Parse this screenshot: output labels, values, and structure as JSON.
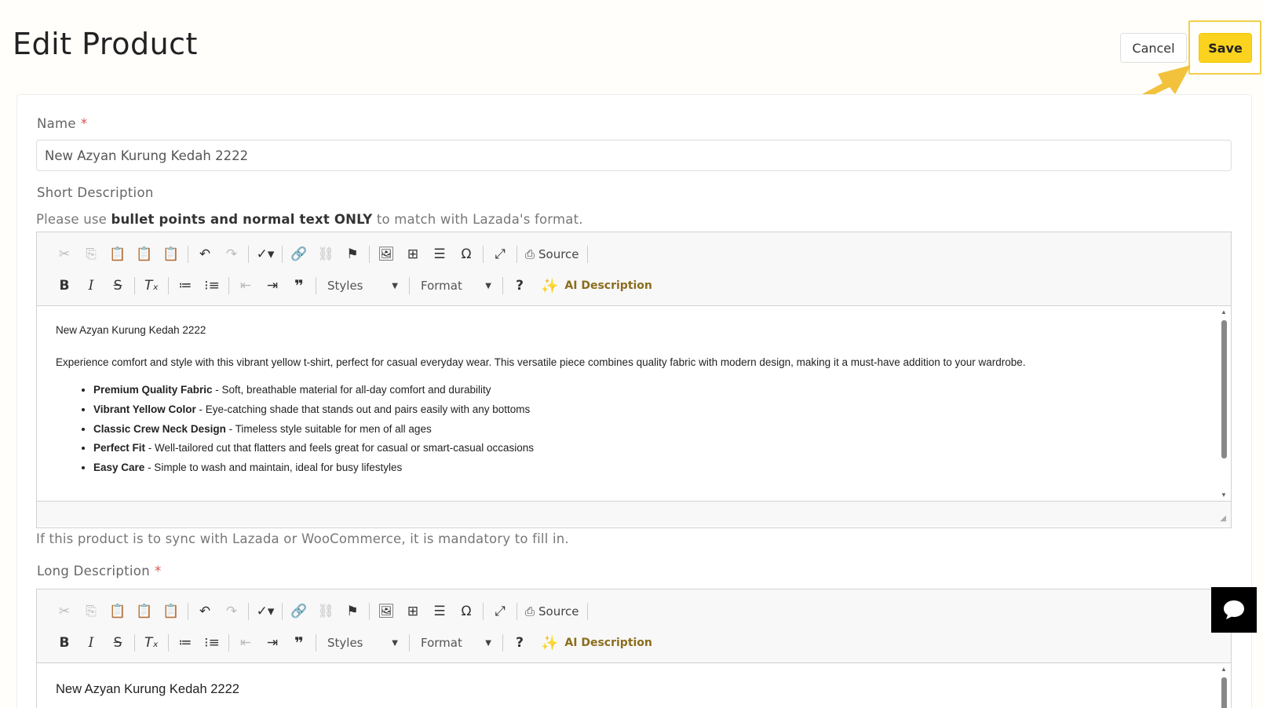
{
  "header": {
    "title": "Edit Product",
    "cancel_label": "Cancel",
    "save_label": "Save"
  },
  "form": {
    "name_label": "Name",
    "required_mark": "*",
    "name_value": "New Azyan Kurung Kedah 2222",
    "short_desc_label": "Short Description",
    "short_desc_hint_pre": "Please use ",
    "short_desc_hint_bold": "bullet points and normal text ONLY",
    "short_desc_hint_post": " to match with Lazada's format.",
    "short_desc_footer_hint": "If this product is to sync with Lazada or WooCommerce, it is mandatory to fill in.",
    "long_desc_label": "Long Description"
  },
  "toolbar": {
    "source_label": "Source",
    "styles_label": "Styles",
    "format_label": "Format",
    "ai_label": "AI Description",
    "help_label": "?"
  },
  "short_editor": {
    "title_line": "New Azyan Kurung Kedah 2222",
    "paragraph": "Experience comfort and style with this vibrant yellow t-shirt, perfect for casual everyday wear. This versatile piece combines quality fabric with modern design, making it a must-have addition to your wardrobe.",
    "bullets": [
      {
        "bold": "Premium Quality Fabric",
        "text": " - Soft, breathable material for all-day comfort and durability"
      },
      {
        "bold": "Vibrant Yellow Color",
        "text": " - Eye-catching shade that stands out and pairs easily with any bottoms"
      },
      {
        "bold": "Classic Crew Neck Design",
        "text": " - Timeless style suitable for men of all ages"
      },
      {
        "bold": "Perfect Fit",
        "text": " - Well-tailored cut that flatters and feels great for casual or smart-casual occasions"
      },
      {
        "bold": "Easy Care",
        "text": " - Simple to wash and maintain, ideal for busy lifestyles"
      }
    ]
  },
  "long_editor": {
    "title_line": "New Azyan Kurung Kedah 2222"
  },
  "colors": {
    "accent": "#fbd21e",
    "highlight": "#f2cf49",
    "required": "#d9534f"
  }
}
